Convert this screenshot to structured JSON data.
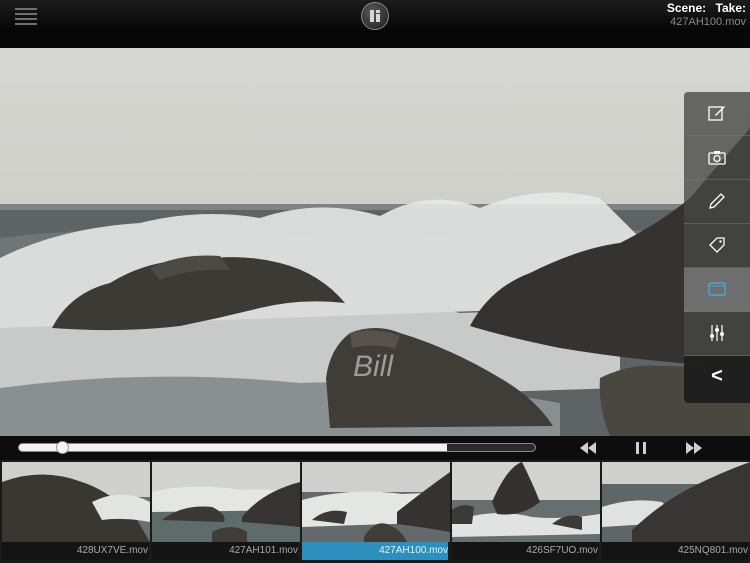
{
  "header": {
    "menu_icon": "hamburger-icon",
    "logo_icon": "app-logo",
    "scene_label": "Scene:",
    "take_label": "Take:",
    "current_file": "427AH100.mov"
  },
  "video": {
    "watermark": "Bill"
  },
  "toolbar": {
    "items": [
      {
        "icon": "edit-note-icon"
      },
      {
        "icon": "camera-icon"
      },
      {
        "icon": "pencil-icon"
      },
      {
        "icon": "tag-icon"
      },
      {
        "icon": "frame-icon",
        "active": true
      },
      {
        "icon": "sliders-icon"
      },
      {
        "icon": "collapse-icon",
        "label": "<"
      }
    ]
  },
  "playback": {
    "progress": 0.085,
    "buffered": 0.83,
    "state": "playing",
    "rewind_icon": "rewind-icon",
    "pause_icon": "pause-icon",
    "forward_icon": "fast-forward-icon"
  },
  "clips": [
    {
      "name": "428UX7VE.mov",
      "selected": false
    },
    {
      "name": "427AH101.mov",
      "selected": false
    },
    {
      "name": "427AH100.mov",
      "selected": true
    },
    {
      "name": "426SF7UO.mov",
      "selected": false
    },
    {
      "name": "425NQ801.mov",
      "selected": false
    }
  ],
  "colors": {
    "accent": "#2d8fbd"
  }
}
